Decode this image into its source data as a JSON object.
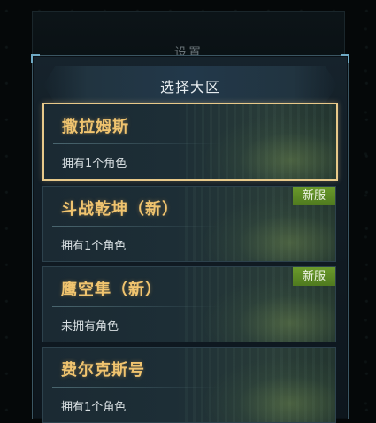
{
  "back_panel": {
    "title": "设置"
  },
  "panel": {
    "title": "选择大区"
  },
  "servers": [
    {
      "name": "撒拉姆斯",
      "status": "拥有1个角色",
      "badge": "",
      "selected": true
    },
    {
      "name": "斗战乾坤（新）",
      "status": "拥有1个角色",
      "badge": "新服",
      "selected": false
    },
    {
      "name": "鹰空隼（新）",
      "status": "未拥有角色",
      "badge": "新服",
      "selected": false
    },
    {
      "name": "费尔克斯号",
      "status": "拥有1个角色",
      "badge": "",
      "selected": false
    }
  ],
  "colors": {
    "accent_gold": "#f0c46f",
    "badge_green": "#5e8c26",
    "selected_border": "#e8c98a"
  }
}
